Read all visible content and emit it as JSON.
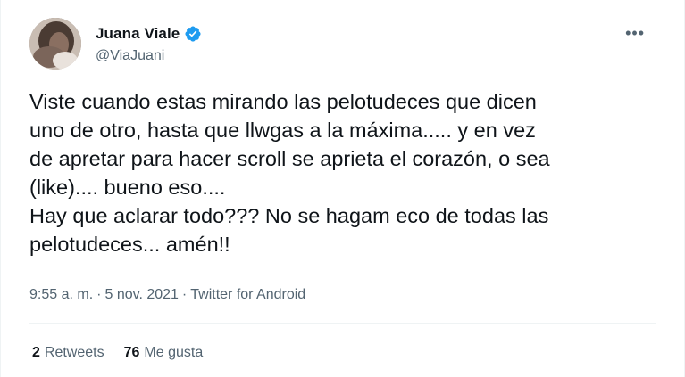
{
  "author": {
    "name": "Juana Viale",
    "handle": "@ViaJuani",
    "verified_icon": "verified-badge-icon",
    "avatar": "profile-photo"
  },
  "menu_icon": "more-options-icon",
  "tweet": {
    "text": "Viste cuando estas mirando las pelotudeces que dicen\nuno de otro, hasta que llwgas a la máxima..... y en vez\nde apretar para hacer scroll se aprieta el corazón, o sea\n(like).... bueno eso....\nHay que aclarar todo??? No se hagam eco de todas las\npelotudeces... amén!!"
  },
  "meta": {
    "time": "9:55 a. m.",
    "separator": "·",
    "date": "5 nov. 2021",
    "source": "Twitter for Android"
  },
  "stats": {
    "retweets_count": "2",
    "retweets_label": "Retweets",
    "likes_count": "76",
    "likes_label": "Me gusta"
  },
  "colors": {
    "verified": "#1d9bf0",
    "secondary_text": "#536471",
    "primary_text": "#0f1419"
  }
}
